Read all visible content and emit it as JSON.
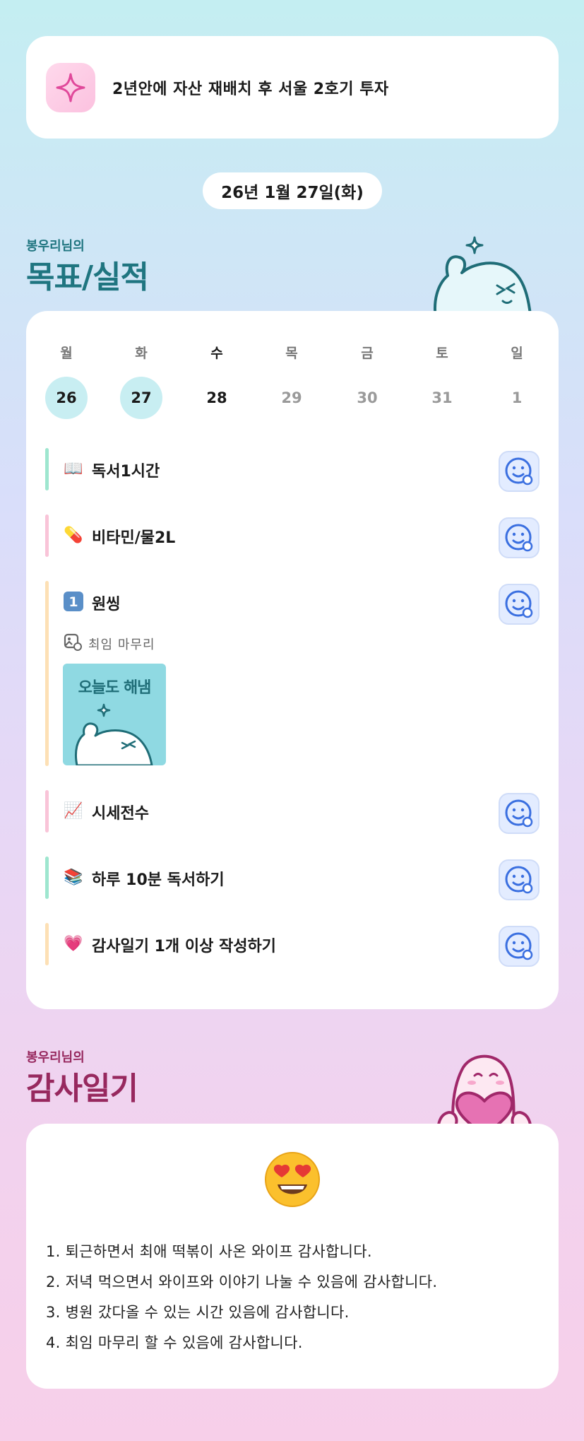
{
  "goal": {
    "text": "2년안에 자산 재배치 후 서울 2호기 투자",
    "icon": "sparkle-icon"
  },
  "date": "26년 1월 27일(화)",
  "goals_section": {
    "subtitle": "봉우리님의",
    "title": "목표/실적"
  },
  "week": {
    "days": [
      {
        "name": "월",
        "num": "26",
        "state": "done"
      },
      {
        "name": "화",
        "num": "27",
        "state": "done"
      },
      {
        "name": "수",
        "num": "28",
        "state": "today"
      },
      {
        "name": "목",
        "num": "29",
        "state": "future"
      },
      {
        "name": "금",
        "num": "30",
        "state": "future"
      },
      {
        "name": "토",
        "num": "31",
        "state": "future"
      },
      {
        "name": "일",
        "num": "1",
        "state": "future"
      }
    ]
  },
  "tasks": [
    {
      "emoji": "📖",
      "label": "독서1시간",
      "bar_color": "#9ee6cf"
    },
    {
      "emoji": "💊",
      "label": "비타민/물2L",
      "bar_color": "#f9c4d8"
    },
    {
      "emoji": "1️⃣",
      "label": "원씽",
      "bar_color": "#fde0b5",
      "note": "최임 마무리",
      "thumb_text": "오늘도 해냄"
    },
    {
      "emoji": "📈",
      "label": "시세전수",
      "bar_color": "#f9c4d8"
    },
    {
      "emoji": "📚",
      "label": "하루 10분 독서하기",
      "bar_color": "#9ee6cf"
    },
    {
      "emoji": "💗",
      "label": "감사일기 1개 이상 작성하기",
      "bar_color": "#fde0b5"
    }
  ],
  "gratitude_section": {
    "subtitle": "봉우리님의",
    "title": "감사일기"
  },
  "gratitude": {
    "emoji": "heart-eyes-face",
    "items": [
      "1. 퇴근하면서 최애 떡볶이 사온 와이프 감사합니다.",
      "2. 저녁 먹으면서 와이프와 이야기 나눌 수 있음에 감사합니다.",
      "3. 병원 갔다올 수 있는 시간 있음에 감사합니다.",
      "4. 최임 마무리 할 수 있음에 감사합니다."
    ]
  },
  "colors": {
    "teal_title": "#1f7580",
    "plum_title": "#97285e",
    "check_blue": "#3a6fe0"
  }
}
